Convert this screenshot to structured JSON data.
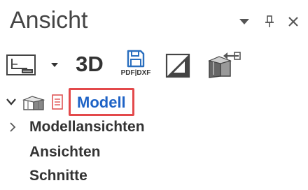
{
  "panel": {
    "title": "Ansicht",
    "controls": {
      "dropdown_icon": "chevron-down-icon",
      "pin_icon": "pin-icon",
      "close_icon": "close-icon"
    }
  },
  "toolbar": {
    "view_button_icon": "drawing-view-icon",
    "three_d_label": "3D",
    "pdf_dxf_label": "PDF|DXF",
    "pdf_dxf_icon": "save-disk-icon",
    "contrast_icon": "contrast-icon",
    "export_icon": "model-export-icon"
  },
  "tree": {
    "root": {
      "label": "Modell",
      "icons": [
        "chevron-down-icon",
        "3d-model-icon",
        "document-icon"
      ]
    },
    "items": [
      {
        "label": "Modellansichten",
        "expandable": true
      },
      {
        "label": "Ansichten",
        "expandable": false
      },
      {
        "label": "Schnitte",
        "expandable": false
      }
    ]
  },
  "colors": {
    "accent_blue": "#1e63c6",
    "highlight_red": "#e3494b",
    "pdf_blue": "#2a6fbf",
    "text": "#333333"
  }
}
